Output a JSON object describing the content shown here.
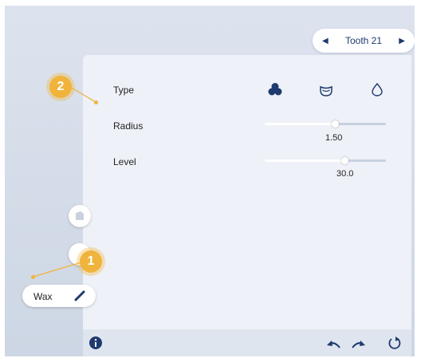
{
  "tooth_nav": {
    "label": "Tooth 21",
    "prev_icon": "triangle-left-icon",
    "next_icon": "triangle-right-icon"
  },
  "panel": {
    "type": {
      "label": "Type",
      "options": [
        "cluster-shape-icon",
        "cup-shape-icon",
        "drop-shape-icon"
      ],
      "selected": 0
    },
    "radius": {
      "label": "Radius",
      "value": "1.50",
      "level": 0.58
    },
    "level": {
      "label": "Level",
      "value": "30.0",
      "level": 0.66
    }
  },
  "tool": {
    "label": "Wax",
    "icon": "pen-icon"
  },
  "callouts": [
    "1",
    "2"
  ],
  "bottom_bar": {
    "icons": [
      "info-icon",
      "undo-icon",
      "redo-icon",
      "reset-icon"
    ]
  },
  "colors": {
    "accent": "#1e3a6e",
    "callout": "#f0b43c"
  }
}
